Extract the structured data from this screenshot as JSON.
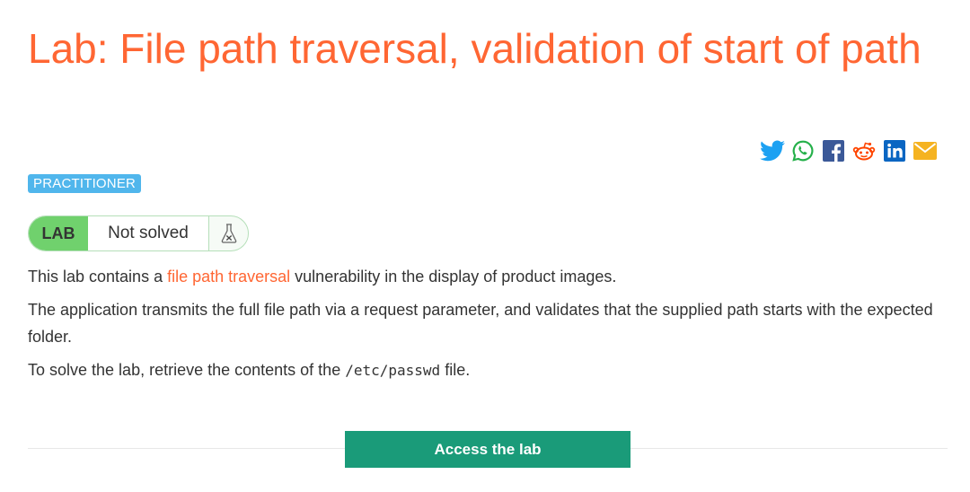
{
  "title": "Lab: File path traversal, validation of start of path",
  "share_icons": [
    "twitter-icon",
    "whatsapp-icon",
    "facebook-icon",
    "reddit-icon",
    "linkedin-icon",
    "email-icon"
  ],
  "badge": "PRACTITIONER",
  "status": {
    "tag": "LAB",
    "state": "Not solved",
    "icon": "flask-icon"
  },
  "description": {
    "p1_before": "This lab contains a ",
    "p1_link": "file path traversal",
    "p1_after": " vulnerability in the display of product images.",
    "p2": "The application transmits the full file path via a request parameter, and validates that the supplied path starts with the expected folder.",
    "p3_before": "To solve the lab, retrieve the contents of the ",
    "p3_code": "/etc/passwd",
    "p3_after": " file."
  },
  "cta_label": "Access the lab",
  "colors": {
    "accent": "#ff6633",
    "badge": "#50b6ec",
    "lab_tag": "#70d16d",
    "cta": "#1a9b79"
  }
}
